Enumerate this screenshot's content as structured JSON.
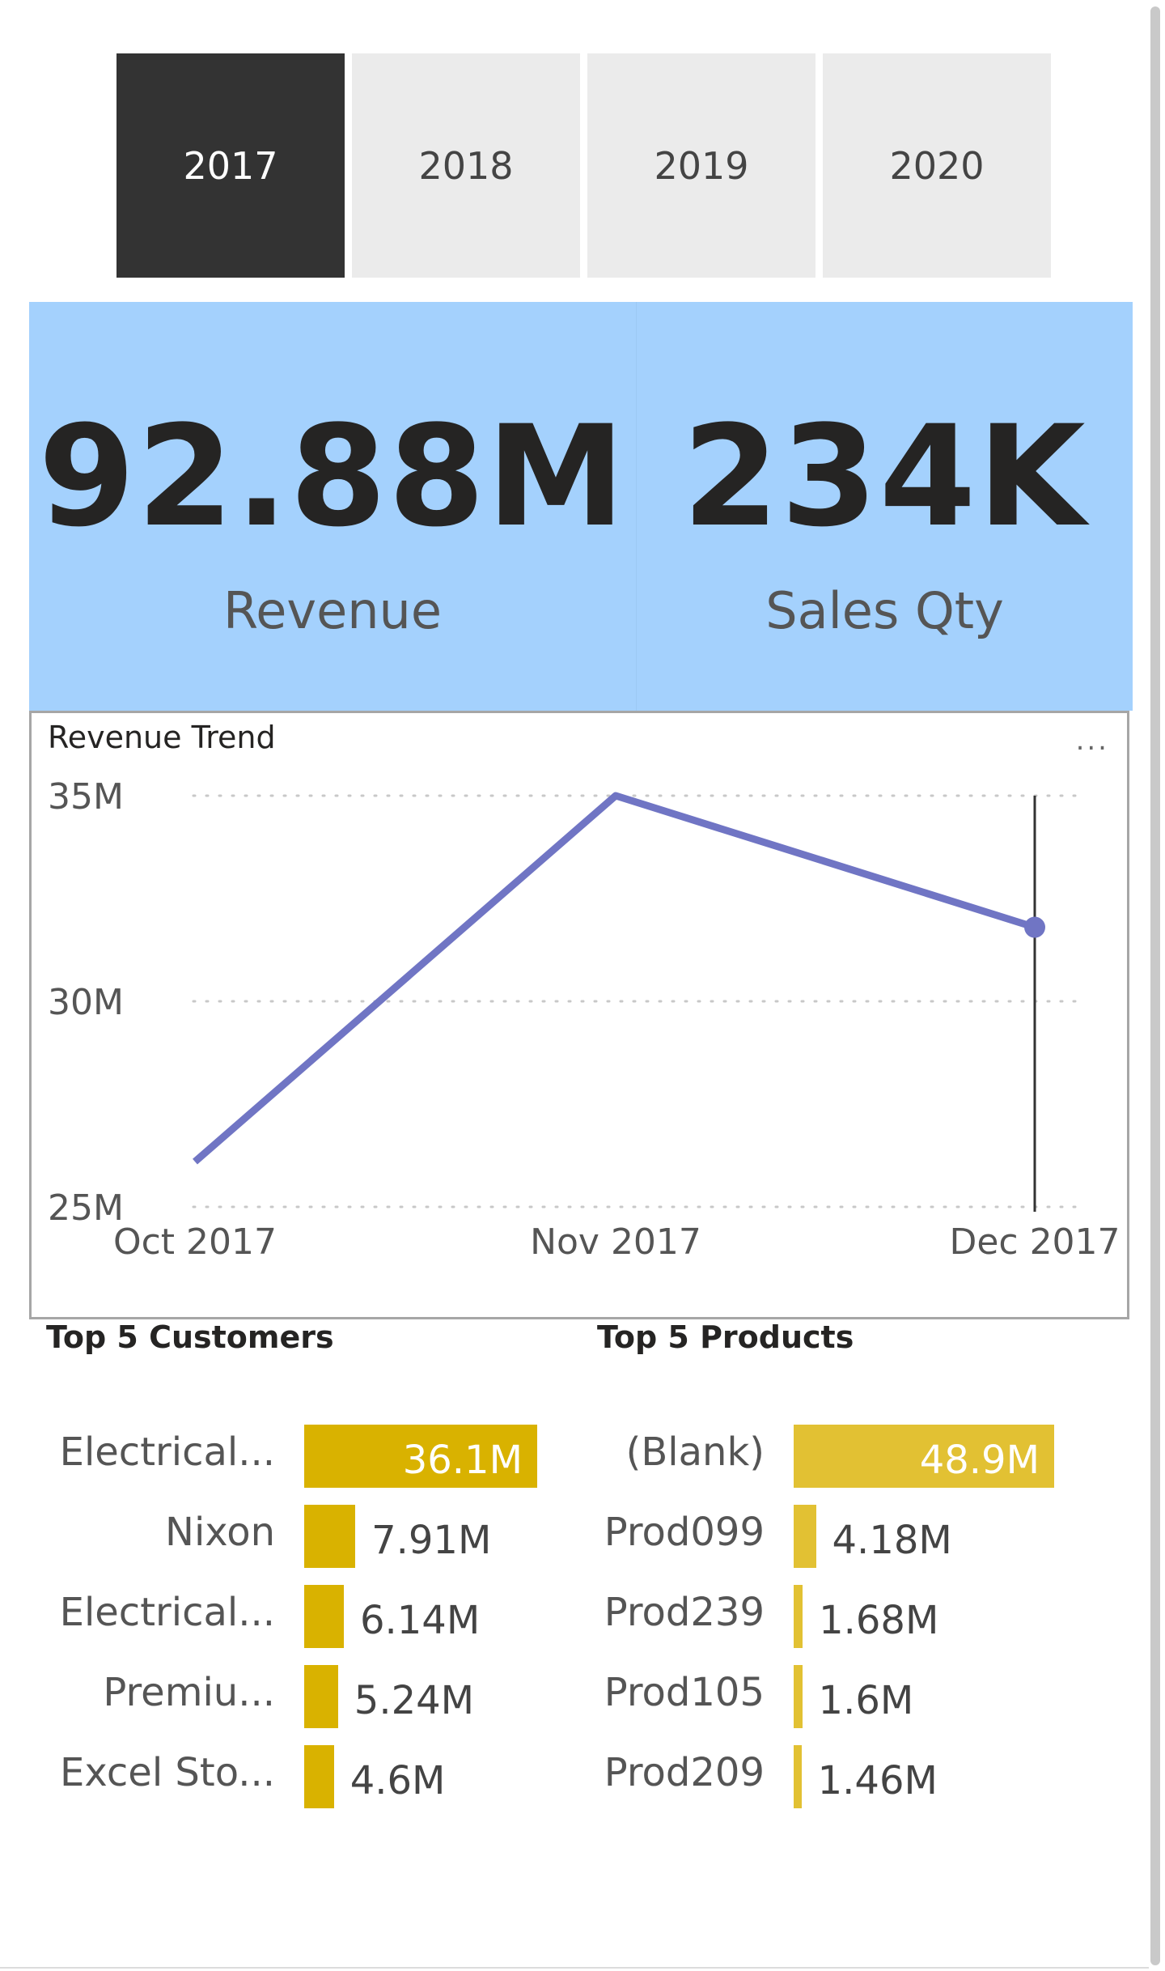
{
  "slicer": {
    "years": [
      "2017",
      "2018",
      "2019",
      "2020"
    ],
    "selected": "2017"
  },
  "kpis": [
    {
      "value": "92.88M",
      "label": "Revenue"
    },
    {
      "value": "234K",
      "label": "Sales Qty"
    }
  ],
  "trend": {
    "title": "Revenue Trend",
    "more_label": "...",
    "line_color": "#7075c4"
  },
  "top_customers_title": "Top 5 Customers",
  "top_products_title": "Top 5 Products",
  "bar_color_customers": "#d9b200",
  "bar_color_products": "#e2c133",
  "chart_data": [
    {
      "type": "line",
      "title": "Revenue Trend",
      "x": [
        "Oct 2017",
        "Nov 2017",
        "Dec 2017"
      ],
      "series": [
        {
          "values": [
            26.1,
            35.0,
            31.8
          ]
        }
      ],
      "y_unit_suffix": "M",
      "ylim": [
        25,
        35
      ],
      "yticks": [
        "25M",
        "30M",
        "35M"
      ],
      "ytick_values": [
        25,
        30,
        35
      ],
      "grid": true,
      "highlight_index": 2
    },
    {
      "type": "bar",
      "orientation": "horizontal",
      "title": "Top 5 Customers",
      "categories": [
        "Electrical...",
        "Nixon",
        "Electrical...",
        "Premiu...",
        "Excel Sto..."
      ],
      "values": [
        36.1,
        7.91,
        6.14,
        5.24,
        4.6
      ],
      "value_labels": [
        "36.1M",
        "7.91M",
        "6.14M",
        "5.24M",
        "4.6M"
      ]
    },
    {
      "type": "bar",
      "orientation": "horizontal",
      "title": "Top 5 Products",
      "categories": [
        "(Blank)",
        "Prod099",
        "Prod239",
        "Prod105",
        "Prod209"
      ],
      "values": [
        48.9,
        4.18,
        1.68,
        1.6,
        1.46
      ],
      "value_labels": [
        "48.9M",
        "4.18M",
        "1.68M",
        "1.6M",
        "1.46M"
      ]
    }
  ]
}
